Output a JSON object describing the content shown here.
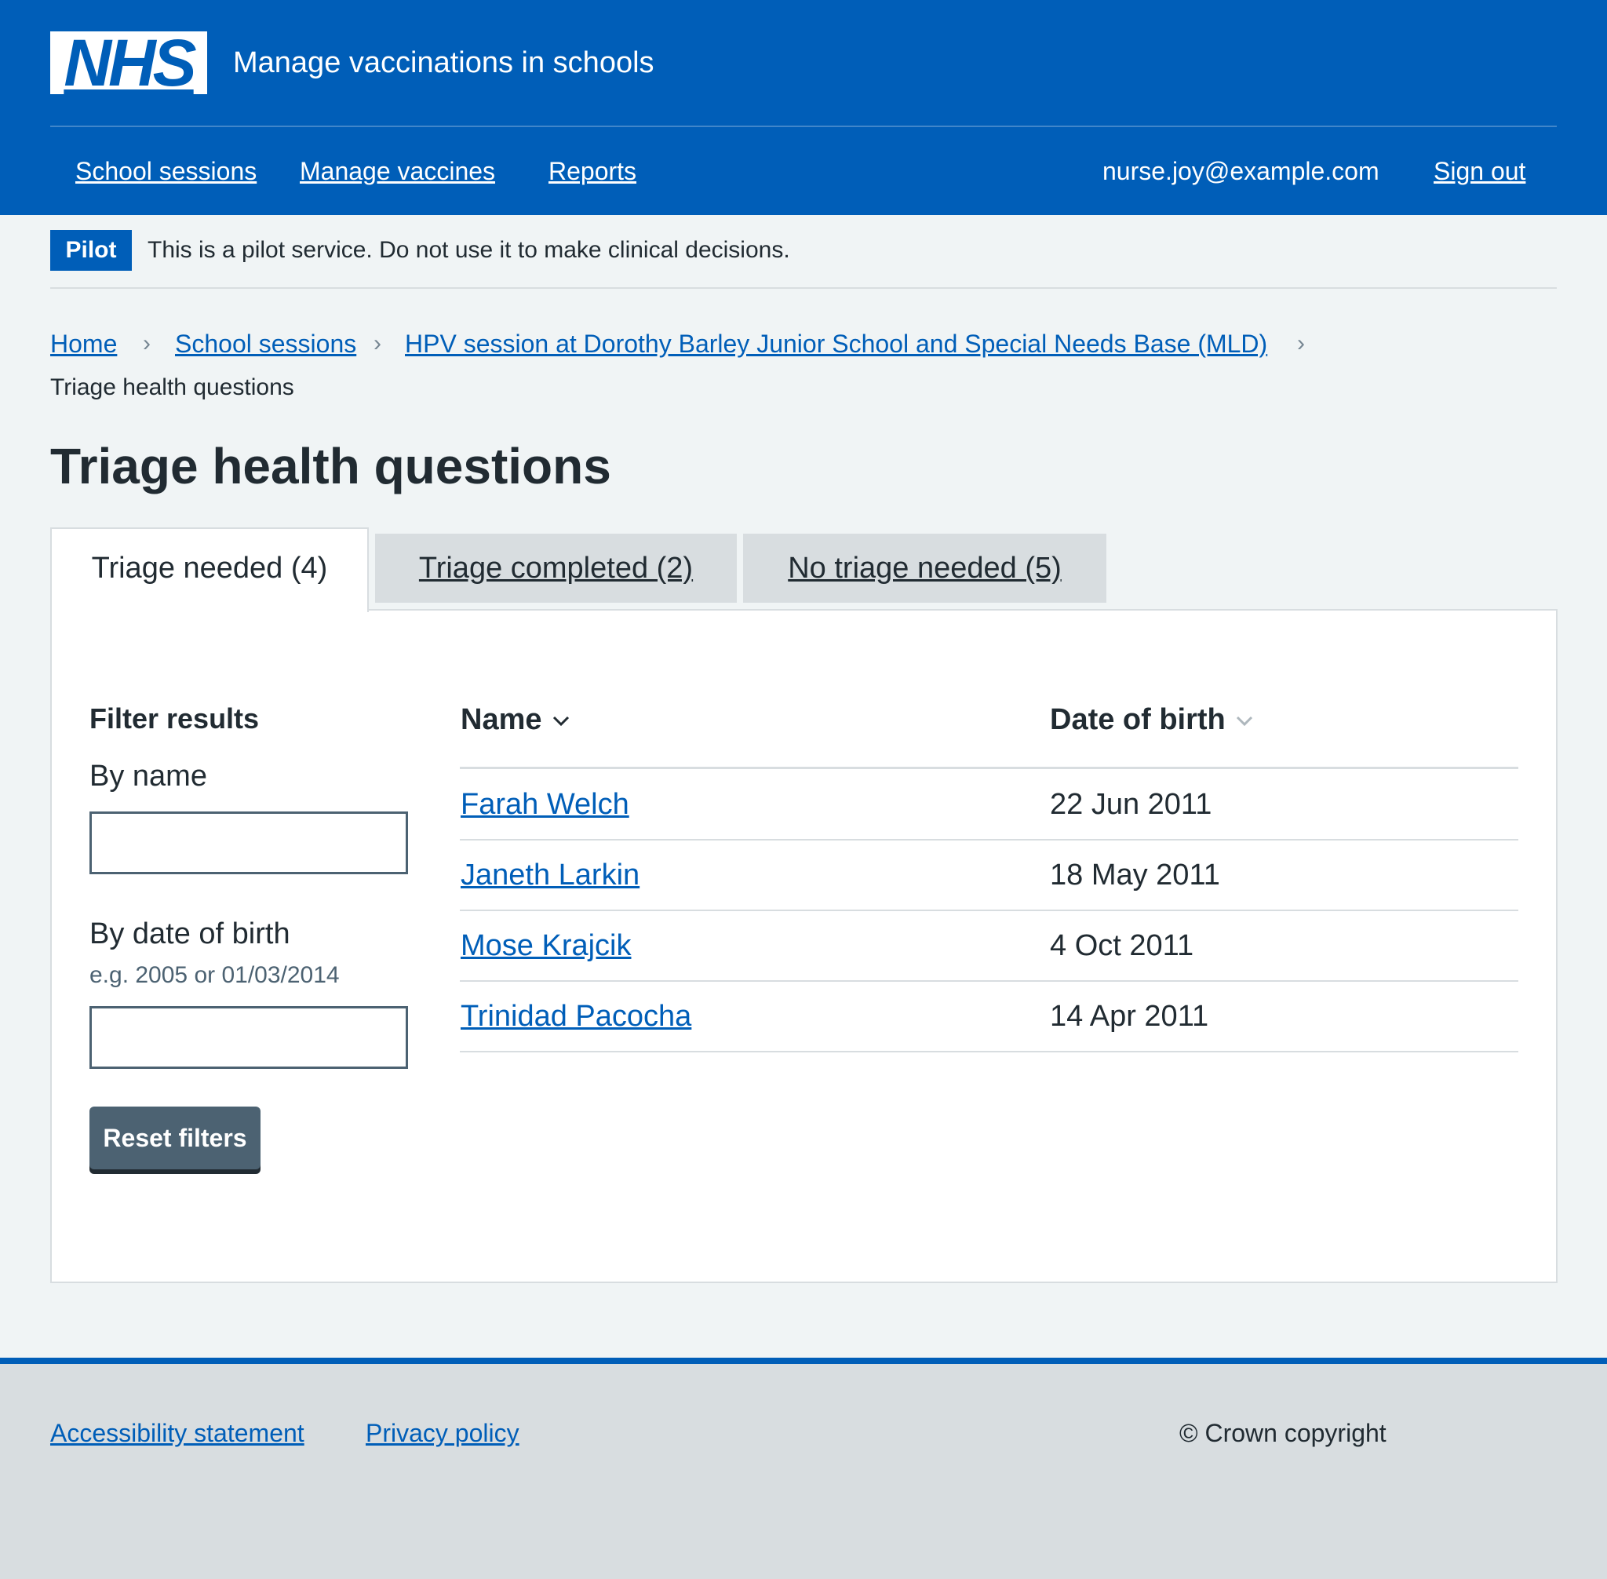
{
  "header": {
    "logo_text": "NHS",
    "service_name": "Manage vaccinations in schools",
    "nav": [
      "School sessions",
      "Manage vaccines",
      "Reports"
    ],
    "account_email": "nurse.joy@example.com",
    "sign_out": "Sign out"
  },
  "pilot": {
    "tag": "Pilot",
    "message": "This is a pilot service. Do not use it to make clinical decisions."
  },
  "breadcrumb": {
    "items": [
      "Home",
      "School sessions",
      "HPV session at Dorothy Barley Junior School and Special Needs Base (MLD)"
    ],
    "current": "Triage health questions"
  },
  "page_title": "Triage health questions",
  "tabs": [
    {
      "label": "Triage needed (4)",
      "active": true
    },
    {
      "label": "Triage completed (2)",
      "active": false
    },
    {
      "label": "No triage needed (5)",
      "active": false
    }
  ],
  "filters": {
    "title": "Filter results",
    "by_name_label": "By name",
    "by_name_value": "",
    "by_dob_label": "By date of birth",
    "by_dob_hint": "e.g. 2005 or 01/03/2014",
    "by_dob_value": "",
    "reset_label": "Reset filters"
  },
  "table": {
    "columns": [
      "Name",
      "Date of birth"
    ],
    "rows": [
      {
        "name": "Farah Welch",
        "dob": "22 Jun 2011"
      },
      {
        "name": "Janeth Larkin",
        "dob": "18 May 2011"
      },
      {
        "name": "Mose Krajcik",
        "dob": "4 Oct 2011"
      },
      {
        "name": "Trinidad Pacocha",
        "dob": "14 Apr 2011"
      }
    ]
  },
  "footer": {
    "links": [
      "Accessibility statement",
      "Privacy policy"
    ],
    "copyright": "© Crown copyright"
  },
  "colors": {
    "nhs_blue": "#005eb8",
    "background": "#f0f4f5",
    "text": "#212b32",
    "secondary_button": "#4c6272",
    "border_grey": "#d8dde0"
  }
}
